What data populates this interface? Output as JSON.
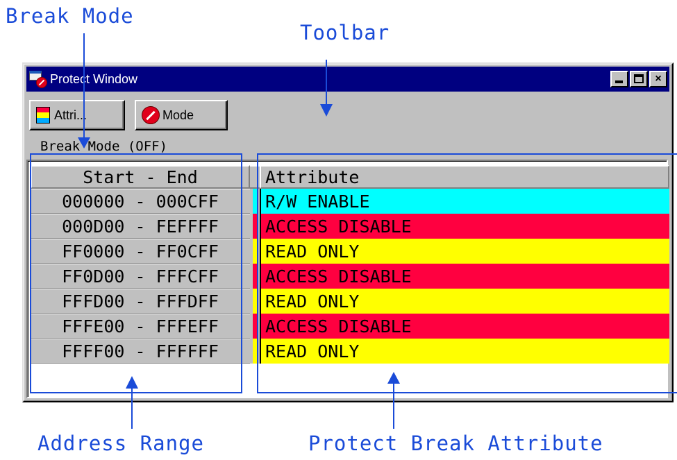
{
  "annotations": {
    "break_mode": "Break Mode",
    "toolbar": "Toolbar",
    "address_range": "Address Range",
    "protect_break_attribute": "Protect Break Attribute",
    "color": "#1a4bd8"
  },
  "window": {
    "title": "Protect Window",
    "icon": "protect-window-icon",
    "controls": [
      "minimize",
      "maximize",
      "close"
    ],
    "close_glyph": "×"
  },
  "toolbar": {
    "attri_label": "Attri...",
    "mode_label": "Mode"
  },
  "status": {
    "break_mode_text": "Break Mode (OFF)"
  },
  "table": {
    "columns": [
      "Start - End",
      "Attribute"
    ],
    "rows": [
      {
        "range": "000000 - 000CFF",
        "attribute": "R/W ENABLE",
        "color": "#00ffff"
      },
      {
        "range": "000D00 - FEFFFF",
        "attribute": "ACCESS DISABLE",
        "color": "#ff0040"
      },
      {
        "range": "FF0000 - FF0CFF",
        "attribute": "READ ONLY",
        "color": "#ffff00"
      },
      {
        "range": "FF0D00 - FFFCFF",
        "attribute": "ACCESS DISABLE",
        "color": "#ff0040"
      },
      {
        "range": "FFFD00 - FFFDFF",
        "attribute": "READ ONLY",
        "color": "#ffff00"
      },
      {
        "range": "FFFE00 - FFFEFF",
        "attribute": "ACCESS DISABLE",
        "color": "#ff0040"
      },
      {
        "range": "FFFF00 - FFFFFF",
        "attribute": "READ ONLY",
        "color": "#ffff00"
      }
    ]
  }
}
